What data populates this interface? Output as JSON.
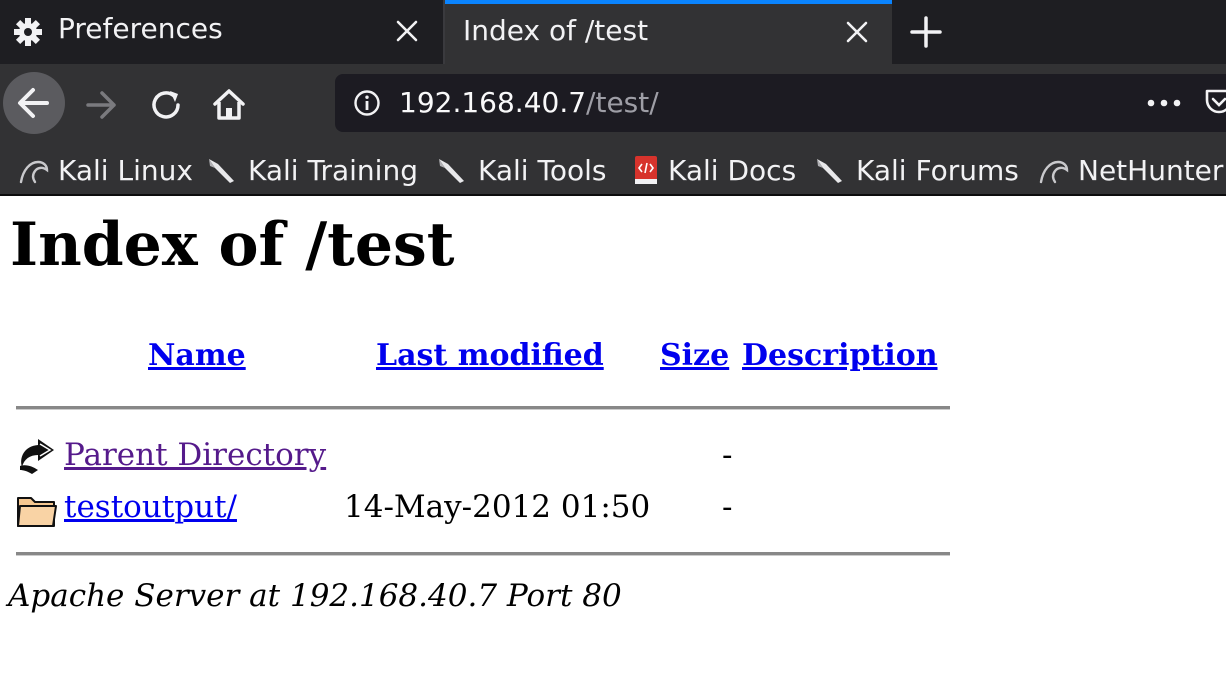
{
  "browser": {
    "tabs": [
      {
        "label": "Preferences",
        "icon": "gear-icon",
        "active": false
      },
      {
        "label": "Index of /test",
        "active": true
      }
    ],
    "url": {
      "host": "192.168.40.7",
      "path": "/test/"
    },
    "bookmarks": [
      {
        "label": "Kali Linux",
        "icon": "kali-dragon-icon"
      },
      {
        "label": "Kali Training",
        "icon": "kali-knife-icon"
      },
      {
        "label": "Kali Tools",
        "icon": "kali-knife-icon"
      },
      {
        "label": "Kali Docs",
        "icon": "kali-docs-icon"
      },
      {
        "label": "Kali Forums",
        "icon": "kali-knife-icon"
      },
      {
        "label": "NetHunter",
        "icon": "kali-dragon-icon"
      }
    ],
    "colors": {
      "tab_accent": "#0a84ff",
      "toolbar": "#323234",
      "tabbar": "#1e1e22"
    }
  },
  "page": {
    "title": "Index of /test",
    "columns": [
      "Name",
      "Last modified",
      "Size",
      "Description"
    ],
    "rows": [
      {
        "icon": "back-arrow-icon",
        "name": "Parent Directory",
        "modified": "",
        "size": "-",
        "description": ""
      },
      {
        "icon": "folder-icon",
        "name": "testoutput/",
        "modified": "14-May-2012 01:50",
        "size": "-",
        "description": ""
      }
    ],
    "footer": "Apache Server at 192.168.40.7 Port 80"
  }
}
